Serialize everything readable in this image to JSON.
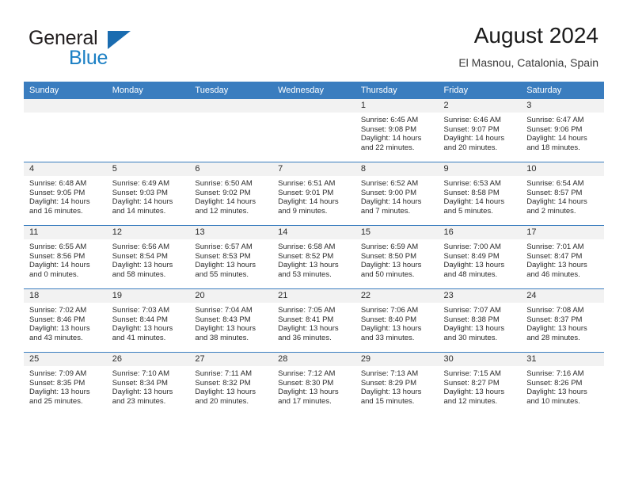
{
  "brand": {
    "word1": "General",
    "word2": "Blue",
    "triangle_color": "#1a6cb0"
  },
  "header": {
    "month_title": "August 2024",
    "location": "El Masnou, Catalonia, Spain"
  },
  "theme": {
    "header_blue": "#3a7dbf",
    "daynum_band": "#f2f2f2",
    "text": "#2b2b2b"
  },
  "weekday_headers": [
    "Sunday",
    "Monday",
    "Tuesday",
    "Wednesday",
    "Thursday",
    "Friday",
    "Saturday"
  ],
  "weeks": [
    [
      {
        "day": "",
        "sunrise": "",
        "sunset": "",
        "daylight1": "",
        "daylight2": ""
      },
      {
        "day": "",
        "sunrise": "",
        "sunset": "",
        "daylight1": "",
        "daylight2": ""
      },
      {
        "day": "",
        "sunrise": "",
        "sunset": "",
        "daylight1": "",
        "daylight2": ""
      },
      {
        "day": "",
        "sunrise": "",
        "sunset": "",
        "daylight1": "",
        "daylight2": ""
      },
      {
        "day": "1",
        "sunrise": "Sunrise: 6:45 AM",
        "sunset": "Sunset: 9:08 PM",
        "daylight1": "Daylight: 14 hours",
        "daylight2": "and 22 minutes."
      },
      {
        "day": "2",
        "sunrise": "Sunrise: 6:46 AM",
        "sunset": "Sunset: 9:07 PM",
        "daylight1": "Daylight: 14 hours",
        "daylight2": "and 20 minutes."
      },
      {
        "day": "3",
        "sunrise": "Sunrise: 6:47 AM",
        "sunset": "Sunset: 9:06 PM",
        "daylight1": "Daylight: 14 hours",
        "daylight2": "and 18 minutes."
      }
    ],
    [
      {
        "day": "4",
        "sunrise": "Sunrise: 6:48 AM",
        "sunset": "Sunset: 9:05 PM",
        "daylight1": "Daylight: 14 hours",
        "daylight2": "and 16 minutes."
      },
      {
        "day": "5",
        "sunrise": "Sunrise: 6:49 AM",
        "sunset": "Sunset: 9:03 PM",
        "daylight1": "Daylight: 14 hours",
        "daylight2": "and 14 minutes."
      },
      {
        "day": "6",
        "sunrise": "Sunrise: 6:50 AM",
        "sunset": "Sunset: 9:02 PM",
        "daylight1": "Daylight: 14 hours",
        "daylight2": "and 12 minutes."
      },
      {
        "day": "7",
        "sunrise": "Sunrise: 6:51 AM",
        "sunset": "Sunset: 9:01 PM",
        "daylight1": "Daylight: 14 hours",
        "daylight2": "and 9 minutes."
      },
      {
        "day": "8",
        "sunrise": "Sunrise: 6:52 AM",
        "sunset": "Sunset: 9:00 PM",
        "daylight1": "Daylight: 14 hours",
        "daylight2": "and 7 minutes."
      },
      {
        "day": "9",
        "sunrise": "Sunrise: 6:53 AM",
        "sunset": "Sunset: 8:58 PM",
        "daylight1": "Daylight: 14 hours",
        "daylight2": "and 5 minutes."
      },
      {
        "day": "10",
        "sunrise": "Sunrise: 6:54 AM",
        "sunset": "Sunset: 8:57 PM",
        "daylight1": "Daylight: 14 hours",
        "daylight2": "and 2 minutes."
      }
    ],
    [
      {
        "day": "11",
        "sunrise": "Sunrise: 6:55 AM",
        "sunset": "Sunset: 8:56 PM",
        "daylight1": "Daylight: 14 hours",
        "daylight2": "and 0 minutes."
      },
      {
        "day": "12",
        "sunrise": "Sunrise: 6:56 AM",
        "sunset": "Sunset: 8:54 PM",
        "daylight1": "Daylight: 13 hours",
        "daylight2": "and 58 minutes."
      },
      {
        "day": "13",
        "sunrise": "Sunrise: 6:57 AM",
        "sunset": "Sunset: 8:53 PM",
        "daylight1": "Daylight: 13 hours",
        "daylight2": "and 55 minutes."
      },
      {
        "day": "14",
        "sunrise": "Sunrise: 6:58 AM",
        "sunset": "Sunset: 8:52 PM",
        "daylight1": "Daylight: 13 hours",
        "daylight2": "and 53 minutes."
      },
      {
        "day": "15",
        "sunrise": "Sunrise: 6:59 AM",
        "sunset": "Sunset: 8:50 PM",
        "daylight1": "Daylight: 13 hours",
        "daylight2": "and 50 minutes."
      },
      {
        "day": "16",
        "sunrise": "Sunrise: 7:00 AM",
        "sunset": "Sunset: 8:49 PM",
        "daylight1": "Daylight: 13 hours",
        "daylight2": "and 48 minutes."
      },
      {
        "day": "17",
        "sunrise": "Sunrise: 7:01 AM",
        "sunset": "Sunset: 8:47 PM",
        "daylight1": "Daylight: 13 hours",
        "daylight2": "and 46 minutes."
      }
    ],
    [
      {
        "day": "18",
        "sunrise": "Sunrise: 7:02 AM",
        "sunset": "Sunset: 8:46 PM",
        "daylight1": "Daylight: 13 hours",
        "daylight2": "and 43 minutes."
      },
      {
        "day": "19",
        "sunrise": "Sunrise: 7:03 AM",
        "sunset": "Sunset: 8:44 PM",
        "daylight1": "Daylight: 13 hours",
        "daylight2": "and 41 minutes."
      },
      {
        "day": "20",
        "sunrise": "Sunrise: 7:04 AM",
        "sunset": "Sunset: 8:43 PM",
        "daylight1": "Daylight: 13 hours",
        "daylight2": "and 38 minutes."
      },
      {
        "day": "21",
        "sunrise": "Sunrise: 7:05 AM",
        "sunset": "Sunset: 8:41 PM",
        "daylight1": "Daylight: 13 hours",
        "daylight2": "and 36 minutes."
      },
      {
        "day": "22",
        "sunrise": "Sunrise: 7:06 AM",
        "sunset": "Sunset: 8:40 PM",
        "daylight1": "Daylight: 13 hours",
        "daylight2": "and 33 minutes."
      },
      {
        "day": "23",
        "sunrise": "Sunrise: 7:07 AM",
        "sunset": "Sunset: 8:38 PM",
        "daylight1": "Daylight: 13 hours",
        "daylight2": "and 30 minutes."
      },
      {
        "day": "24",
        "sunrise": "Sunrise: 7:08 AM",
        "sunset": "Sunset: 8:37 PM",
        "daylight1": "Daylight: 13 hours",
        "daylight2": "and 28 minutes."
      }
    ],
    [
      {
        "day": "25",
        "sunrise": "Sunrise: 7:09 AM",
        "sunset": "Sunset: 8:35 PM",
        "daylight1": "Daylight: 13 hours",
        "daylight2": "and 25 minutes."
      },
      {
        "day": "26",
        "sunrise": "Sunrise: 7:10 AM",
        "sunset": "Sunset: 8:34 PM",
        "daylight1": "Daylight: 13 hours",
        "daylight2": "and 23 minutes."
      },
      {
        "day": "27",
        "sunrise": "Sunrise: 7:11 AM",
        "sunset": "Sunset: 8:32 PM",
        "daylight1": "Daylight: 13 hours",
        "daylight2": "and 20 minutes."
      },
      {
        "day": "28",
        "sunrise": "Sunrise: 7:12 AM",
        "sunset": "Sunset: 8:30 PM",
        "daylight1": "Daylight: 13 hours",
        "daylight2": "and 17 minutes."
      },
      {
        "day": "29",
        "sunrise": "Sunrise: 7:13 AM",
        "sunset": "Sunset: 8:29 PM",
        "daylight1": "Daylight: 13 hours",
        "daylight2": "and 15 minutes."
      },
      {
        "day": "30",
        "sunrise": "Sunrise: 7:15 AM",
        "sunset": "Sunset: 8:27 PM",
        "daylight1": "Daylight: 13 hours",
        "daylight2": "and 12 minutes."
      },
      {
        "day": "31",
        "sunrise": "Sunrise: 7:16 AM",
        "sunset": "Sunset: 8:26 PM",
        "daylight1": "Daylight: 13 hours",
        "daylight2": "and 10 minutes."
      }
    ]
  ]
}
